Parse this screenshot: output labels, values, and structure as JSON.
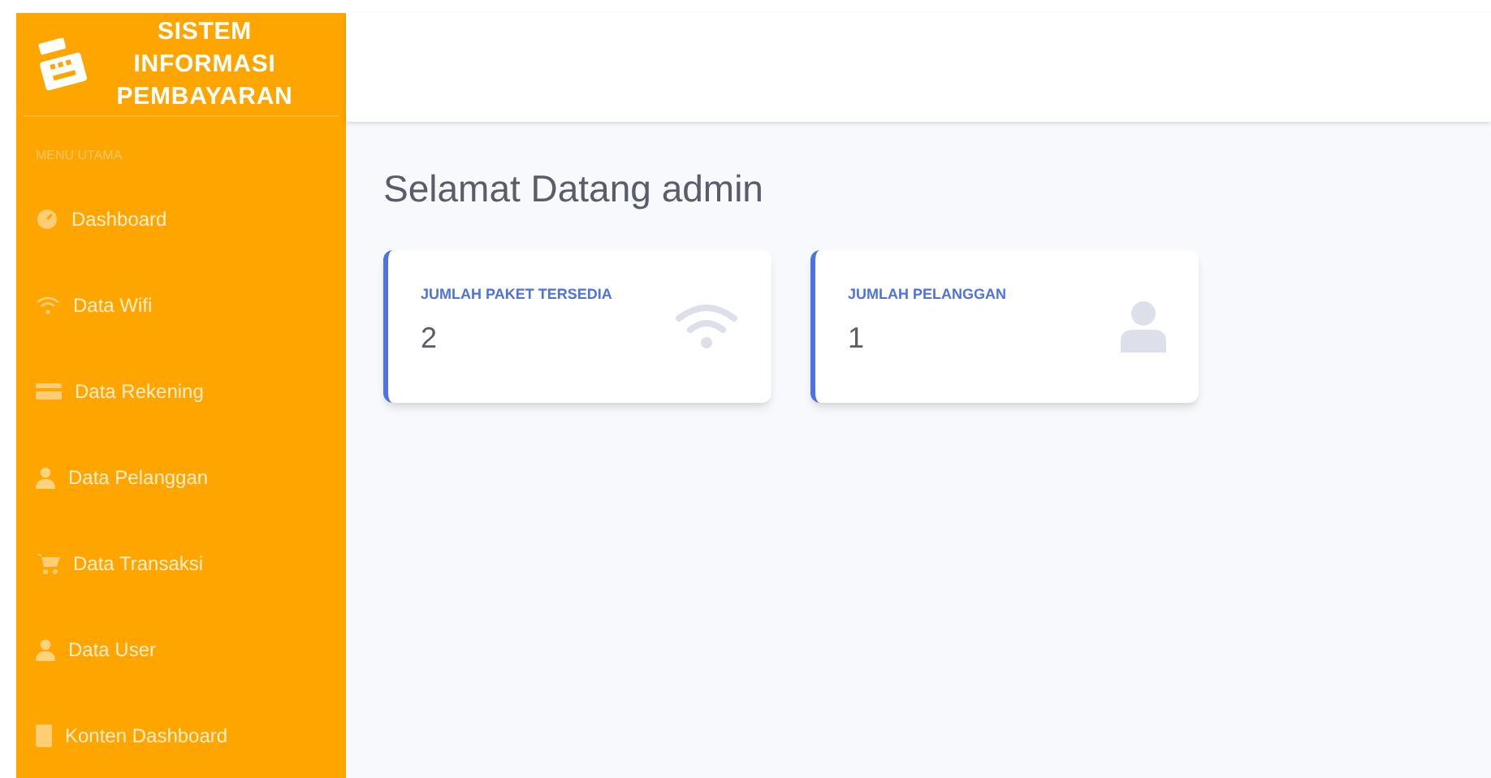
{
  "brand": {
    "title": "SISTEM INFORMASI PEMBAYARAN"
  },
  "sidebar": {
    "heading": "MENU UTAMA",
    "items": [
      {
        "label": "Dashboard",
        "kind": "gauge"
      },
      {
        "label": "Data Wifi",
        "kind": "wifi"
      },
      {
        "label": "Data Rekening",
        "kind": "card"
      },
      {
        "label": "Data Pelanggan",
        "kind": "user"
      },
      {
        "label": "Data Transaksi",
        "kind": "cart"
      },
      {
        "label": "Data User",
        "kind": "user"
      },
      {
        "label": "Konten Dashboard",
        "kind": "file"
      }
    ]
  },
  "page": {
    "heading": "Selamat Datang admin"
  },
  "cards": [
    {
      "label": "JUMLAH PAKET TERSEDIA",
      "value": "2",
      "kind": "wifi"
    },
    {
      "label": "JUMLAH PELANGGAN",
      "value": "1",
      "kind": "user"
    }
  ]
}
